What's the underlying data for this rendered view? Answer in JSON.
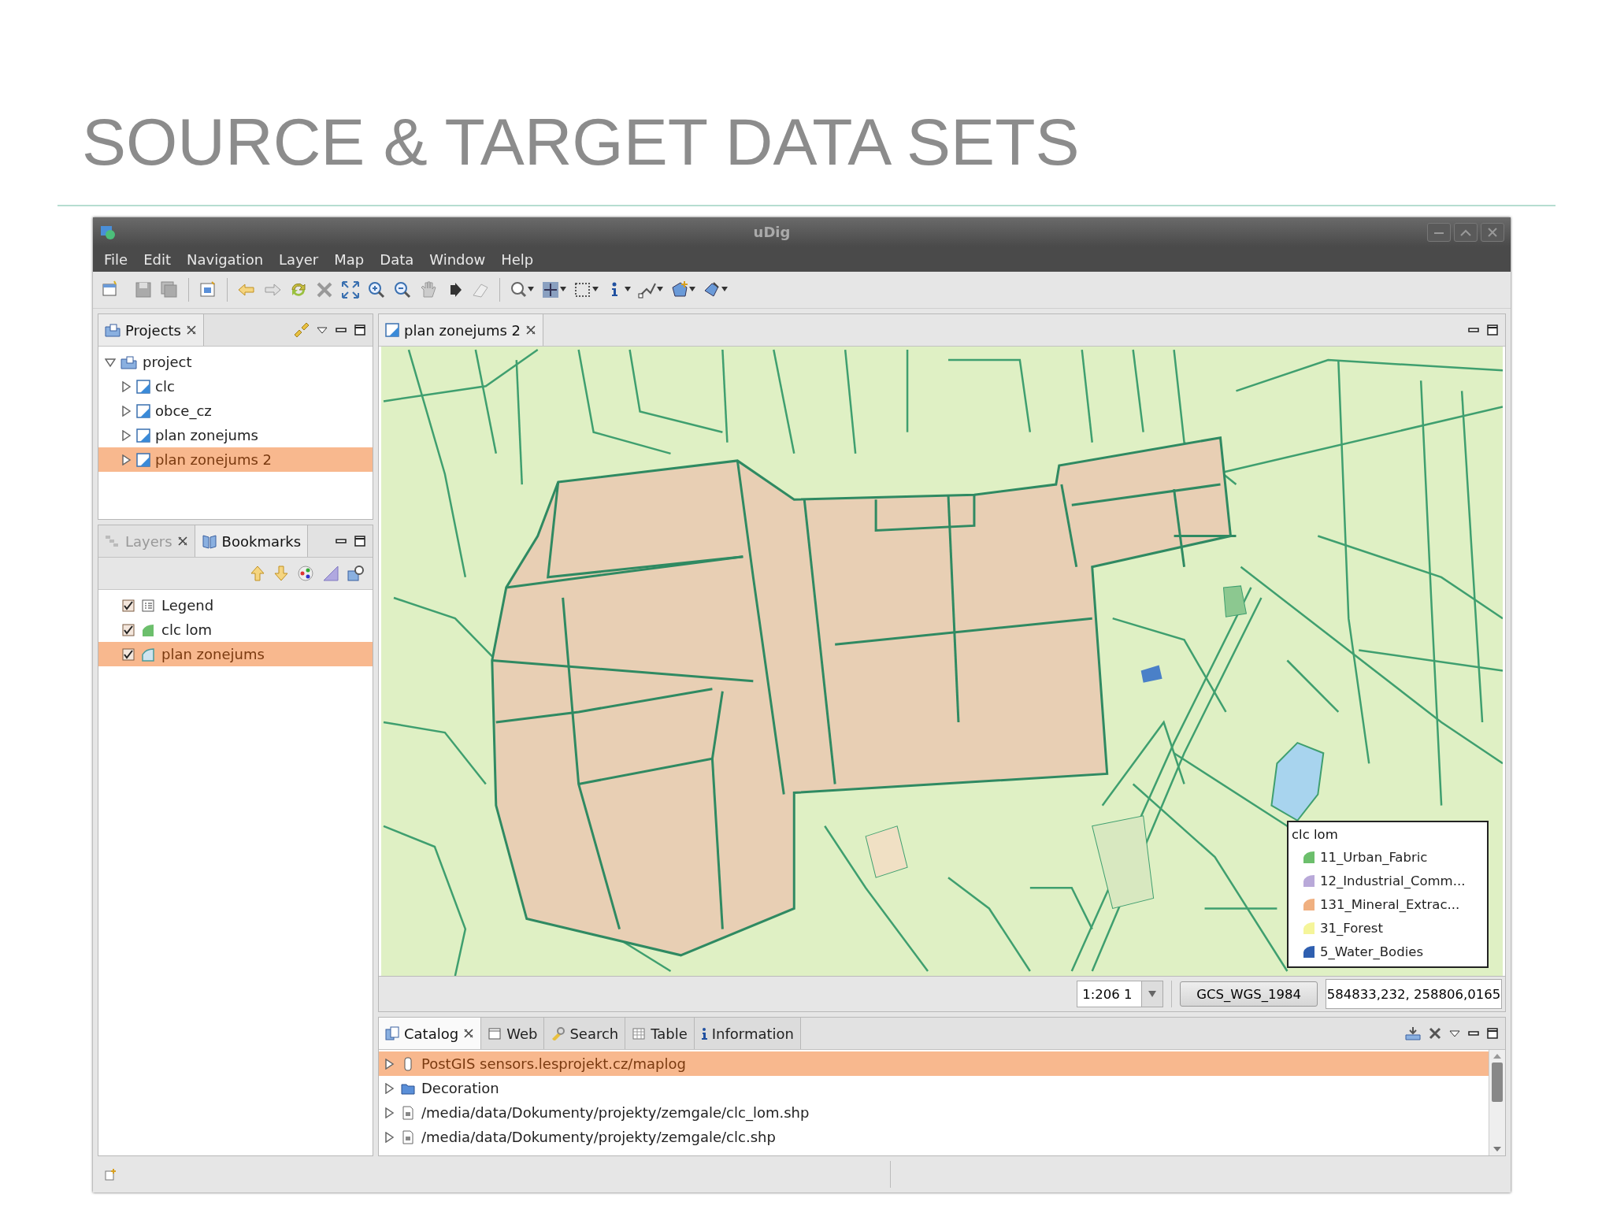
{
  "slide": {
    "title": "SOURCE & TARGET DATA SETS"
  },
  "window": {
    "title": "uDig"
  },
  "menu": [
    {
      "label": "File"
    },
    {
      "label": "Edit"
    },
    {
      "label": "Navigation"
    },
    {
      "label": "Layer"
    },
    {
      "label": "Map"
    },
    {
      "label": "Data"
    },
    {
      "label": "Window"
    },
    {
      "label": "Help"
    }
  ],
  "projects_panel": {
    "tab": {
      "label": "Projects",
      "selected": true,
      "closable": true
    },
    "tree": {
      "label": "project",
      "expanded": true,
      "selected": false,
      "children": [
        {
          "label": "clc",
          "expanded": false,
          "selected": false
        },
        {
          "label": "obce_cz",
          "expanded": false,
          "selected": false
        },
        {
          "label": "plan zonejums",
          "expanded": false,
          "selected": false
        },
        {
          "label": "plan zonejums 2",
          "expanded": false,
          "selected": true
        }
      ]
    }
  },
  "layers_panel": {
    "tabs": [
      {
        "label": "Layers",
        "selected": false,
        "closable": true
      },
      {
        "label": "Bookmarks",
        "selected": true,
        "closable": false
      }
    ],
    "layers": [
      {
        "label": "Legend",
        "kind": "legend",
        "checked": true,
        "selected": false
      },
      {
        "label": "clc lom",
        "kind": "filled",
        "checked": true,
        "selected": false
      },
      {
        "label": "plan zonejums",
        "kind": "outline",
        "checked": true,
        "selected": true
      }
    ]
  },
  "map": {
    "tab": {
      "label": "plan zonejums 2",
      "selected": true,
      "closable": true
    },
    "legend": {
      "title": "clc lom",
      "items": [
        {
          "label": "11_Urban_Fabric",
          "color": "#6cbf6c"
        },
        {
          "label": "12_Industrial_Comm...",
          "color": "#b9a9d9"
        },
        {
          "label": "131_Mineral_Extrac...",
          "color": "#f0b080"
        },
        {
          "label": "31_Forest",
          "color": "#f5f59a"
        },
        {
          "label": "5_Water_Bodies",
          "color": "#2f5fb0"
        }
      ]
    },
    "scale": "1:206 1",
    "crs": "GCS_WGS_1984",
    "coordinates": "584833,232, 258806,0165"
  },
  "bottom_panel": {
    "tabs": [
      {
        "label": "Catalog",
        "kind": "catalog",
        "selected": true,
        "closable": true
      },
      {
        "label": "Web",
        "kind": "web",
        "selected": false,
        "closable": false
      },
      {
        "label": "Search",
        "kind": "search",
        "selected": false,
        "closable": false
      },
      {
        "label": "Table",
        "kind": "table",
        "selected": false,
        "closable": false
      },
      {
        "label": "Information",
        "kind": "info",
        "selected": false,
        "closable": false
      }
    ],
    "items": [
      {
        "label": "PostGIS sensors.lesprojekt.cz/maplog",
        "kind": "database",
        "selected": true,
        "expanded": false
      },
      {
        "label": "Decoration",
        "kind": "folder",
        "selected": false,
        "expanded": false
      },
      {
        "label": "/media/data/Dokumenty/projekty/zemgale/clc_lom.shp",
        "kind": "file",
        "selected": false,
        "expanded": false
      },
      {
        "label": "/media/data/Dokumenty/projekty/zemgale/clc.shp",
        "kind": "file",
        "selected": false,
        "expanded": false
      }
    ]
  }
}
